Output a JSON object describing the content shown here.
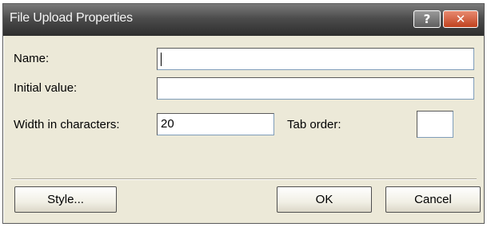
{
  "dialog": {
    "title": "File Upload Properties",
    "help_glyph": "?",
    "close_glyph": "✕"
  },
  "fields": {
    "name_label": "Name:",
    "name_value": "",
    "initial_value_label": "Initial value:",
    "initial_value_value": "",
    "width_label": "Width in characters:",
    "width_value": "20",
    "tab_order_label": "Tab order:",
    "tab_order_value": ""
  },
  "buttons": {
    "style_label": "Style...",
    "ok_label": "OK",
    "cancel_label": "Cancel"
  },
  "colors": {
    "dialog_face": "#ece9d8",
    "titlebar": "#4c4c4c",
    "close_button": "#c0421f"
  },
  "icons": {
    "help": "help-icon",
    "close": "close-icon"
  }
}
